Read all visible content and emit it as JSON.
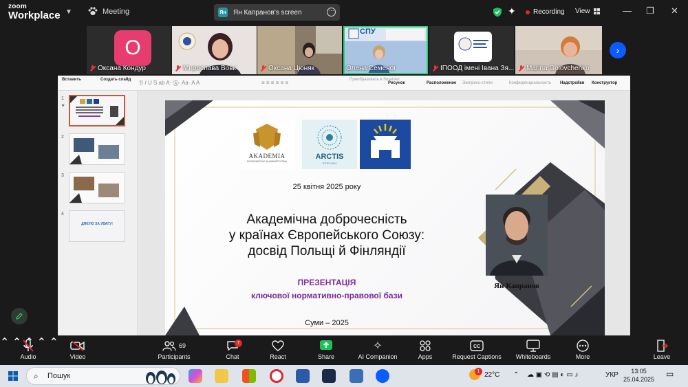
{
  "app": {
    "brand_line1": "zoom",
    "brand_line2": "Workplace",
    "meeting_label": "Meeting",
    "share_avatar": "Ян",
    "share_label": "Ян Капранов's screen",
    "recording_label": "Recording",
    "view_label": "View"
  },
  "gallery": {
    "participants": [
      {
        "name": "Оксана Кондур",
        "initial": "О",
        "muted": true
      },
      {
        "name": "Мирослава Вовк",
        "muted": true
      },
      {
        "name": "Оксана Цюняк",
        "muted": true
      },
      {
        "name": "Олена Семеног",
        "muted": false,
        "active": true
      },
      {
        "name": "ІПООД імені Івана Зя...",
        "muted": true
      },
      {
        "name": "Marina Golovchenko",
        "muted": true
      }
    ],
    "tile3_logo_text": "СПУ"
  },
  "ppt": {
    "ribbon": {
      "paste": "Вставить",
      "new_slide": "Создать слайд",
      "smartart": "Преобразовать в SmartArt",
      "picture": "Рисунок",
      "arrange": "Расположение",
      "quick_styles": "Экспресс-стили",
      "confidentiality": "Конфиденциальность",
      "addins": "Надстройки",
      "designer": "Конструктор"
    },
    "thumbnails": [
      {
        "num": "1",
        "selected": true
      },
      {
        "num": "2",
        "selected": false
      },
      {
        "num": "3",
        "selected": false
      },
      {
        "num": "4",
        "selected": false,
        "text": "ДЯКУЮ ЗА УВАГУ!"
      }
    ],
    "slide": {
      "logo1": "AKADEMIA",
      "logo1_sub": "EKONOMICZNO-HUMANISTYCZNA",
      "logo2": "ARCTIS",
      "logo2_sub": "ESTD 2024",
      "date": "25 квітня 2025 року",
      "title_lines": [
        "Академічна доброчесність",
        "у країнах Європейського Союзу:",
        "досвід Польщі й Фінляндії"
      ],
      "pres_line1": "ПРЕЗЕНТАЦІЯ",
      "pres_line2": "ключової нормативно-правової бази",
      "city": "Суми – 2025",
      "author": "Ян Капранов"
    }
  },
  "controls": {
    "audio": "Audio",
    "video": "Video",
    "participants": "Participants",
    "participants_count": "69",
    "chat": "Chat",
    "chat_badge": "7",
    "react": "React",
    "share": "Share",
    "ai": "AI Companion",
    "apps": "Apps",
    "captions": "Request Captions",
    "whiteboards": "Whiteboards",
    "more": "More",
    "leave": "Leave"
  },
  "taskbar": {
    "search_placeholder": "Пошук",
    "weather": "22°C",
    "weather_badge": "1",
    "lang": "УКР",
    "time": "13:05",
    "date": "25.04.2025"
  },
  "colors": {
    "zoom_blue": "#0b5cff",
    "active_green": "#2bd37a",
    "record_red": "#e02828",
    "slide_purple": "#7a2b9a",
    "share_green": "#1fbf5a"
  }
}
